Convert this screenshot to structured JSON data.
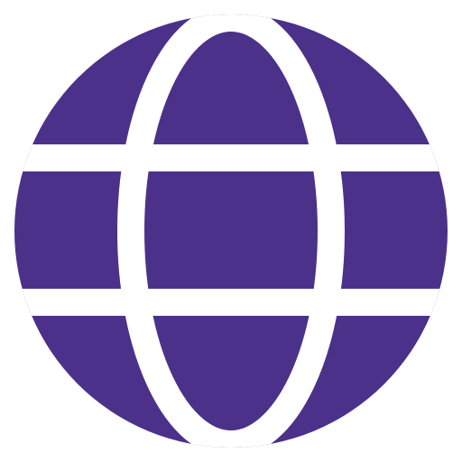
{
  "icon": {
    "name": "globe-icon",
    "color": "#4b318a",
    "background": "#ffffff"
  }
}
